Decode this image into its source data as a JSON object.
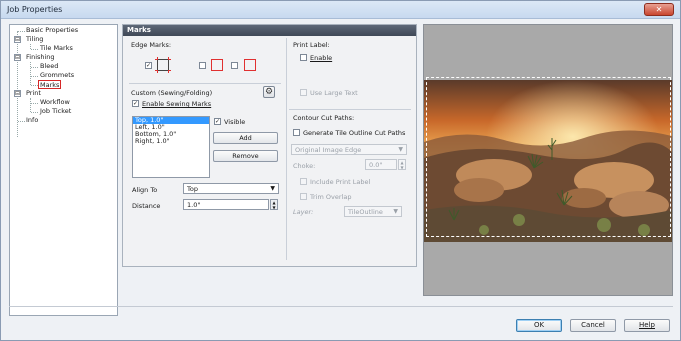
{
  "window": {
    "title": "Job Properties",
    "close_icon": "close-icon"
  },
  "tree": {
    "items": [
      {
        "label": "Basic Properties"
      },
      {
        "label": "Tiling",
        "expander": "⊟"
      },
      {
        "label": "Tile Marks"
      },
      {
        "label": "Finishing",
        "expander": "⊟"
      },
      {
        "label": "Bleed"
      },
      {
        "label": "Grommets"
      },
      {
        "label": "Marks"
      },
      {
        "label": "Print",
        "expander": "⊟"
      },
      {
        "label": "Workflow"
      },
      {
        "label": "Job Ticket"
      },
      {
        "label": "Info"
      }
    ]
  },
  "panel": {
    "header": "Marks",
    "edge_marks_label": "Edge Marks:",
    "print_label_title": "Print Label:",
    "enable_label": "Enable",
    "use_large_text_label": "Use Large Text",
    "custom_label": "Custom (Sewing/Folding)",
    "enable_sewing_label": "Enable Sewing Marks",
    "visible_label": "Visible",
    "list_items": [
      "Top, 1.0\"",
      "Left, 1.0\"",
      "Bottom, 1.0\"",
      "Right, 1.0\""
    ],
    "add_button": "Add",
    "remove_button": "Remove",
    "align_to_label": "Align To",
    "align_to_value": "Top",
    "distance_label": "Distance",
    "distance_value": "1.0\"",
    "contour_title": "Contour Cut Paths:",
    "generate_label": "Generate Tile Outline Cut Paths",
    "original_edge_value": "Original Image Edge",
    "choke_label": "Choke:",
    "choke_value": "0.0\"",
    "include_label": "Include Print Label",
    "trim_label": "Trim Overlap",
    "layer_label": "Layer:",
    "layer_value": "TileOutline",
    "checked_glyph": "✓",
    "arrow_down": "▼",
    "spin_up": "▲",
    "spin_down": "▼",
    "gear_icon": "⚙"
  },
  "footer": {
    "ok": "OK",
    "cancel": "Cancel",
    "help": "Help"
  },
  "colors": {
    "accent": "#3399ff",
    "highlight": "#d62828",
    "preview_bg": "#a9a9a9"
  }
}
